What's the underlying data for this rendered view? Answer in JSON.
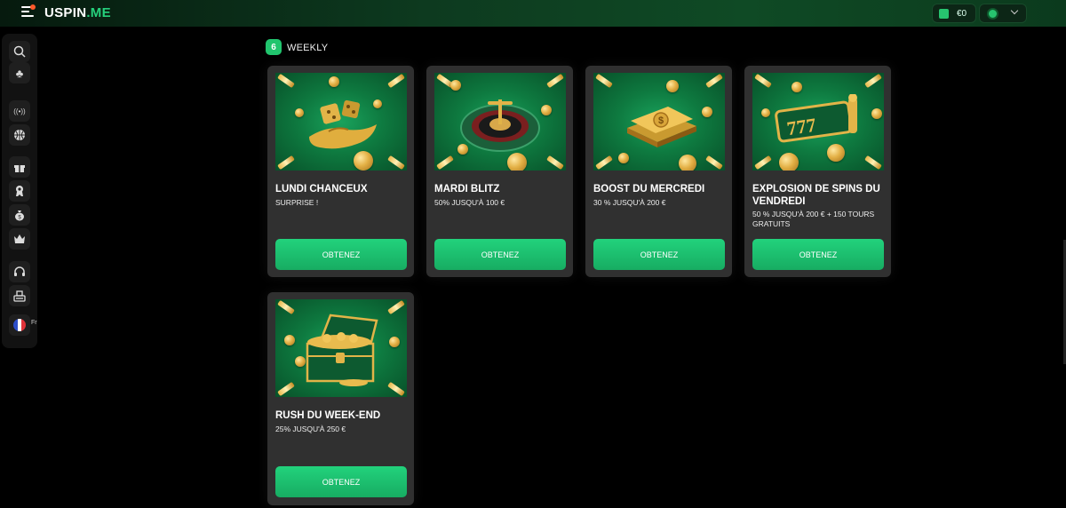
{
  "header": {
    "logo_main": "USPIN",
    "logo_suffix": ".ME",
    "balance": "€0",
    "accent": "#26d07c"
  },
  "sidebar": {
    "items": [
      {
        "icon": "search-icon",
        "glyph": "⌕"
      },
      {
        "icon": "club-icon",
        "glyph": "♣"
      },
      {
        "icon": "live-broadcast-icon",
        "glyph": "((•))"
      },
      {
        "icon": "sports-ball-icon",
        "glyph": "◉"
      },
      {
        "icon": "gift-icon",
        "glyph": "🎁"
      },
      {
        "icon": "medal-icon",
        "glyph": "✪"
      },
      {
        "icon": "money-bag-icon",
        "glyph": "$"
      },
      {
        "icon": "crown-icon",
        "glyph": "♛"
      },
      {
        "icon": "headset-icon",
        "glyph": "☊"
      },
      {
        "icon": "cashier-icon",
        "glyph": "▤"
      }
    ],
    "language_label": "Fr"
  },
  "section": {
    "badge": "6",
    "title": "WEEKLY"
  },
  "promotions": [
    {
      "title": "LUNDI CHANCEUX",
      "subtitle": "SURPRISE !",
      "button": "OBTENEZ",
      "image": "dice-hand-image"
    },
    {
      "title": "MARDI BLITZ",
      "subtitle": "50% JUSQU'À 100 €",
      "button": "OBTENEZ",
      "image": "roulette-image"
    },
    {
      "title": "BOOST DU MERCREDI",
      "subtitle": "30 % JUSQU'À 200 €",
      "button": "OBTENEZ",
      "image": "cash-stack-image"
    },
    {
      "title": "EXPLOSION DE SPINS DU VENDREDI",
      "subtitle": "50 % JUSQU'À 200 € + 150 TOURS GRATUITS",
      "button": "OBTENEZ",
      "image": "slot-reels-image"
    },
    {
      "title": "RUSH DU WEEK-END",
      "subtitle": "25% JUSQU'À 250 €",
      "button": "OBTENEZ",
      "image": "treasure-chest-image"
    }
  ]
}
